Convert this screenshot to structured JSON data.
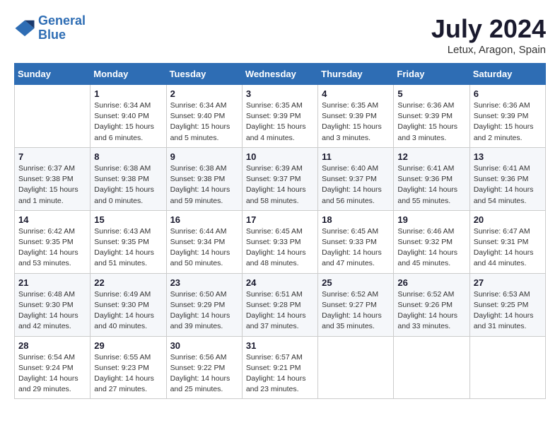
{
  "logo": {
    "line1": "General",
    "line2": "Blue"
  },
  "title": "July 2024",
  "location": "Letux, Aragon, Spain",
  "days_header": [
    "Sunday",
    "Monday",
    "Tuesday",
    "Wednesday",
    "Thursday",
    "Friday",
    "Saturday"
  ],
  "weeks": [
    [
      {
        "day": "",
        "sunrise": "",
        "sunset": "",
        "daylight": ""
      },
      {
        "day": "1",
        "sunrise": "Sunrise: 6:34 AM",
        "sunset": "Sunset: 9:40 PM",
        "daylight": "Daylight: 15 hours and 6 minutes."
      },
      {
        "day": "2",
        "sunrise": "Sunrise: 6:34 AM",
        "sunset": "Sunset: 9:40 PM",
        "daylight": "Daylight: 15 hours and 5 minutes."
      },
      {
        "day": "3",
        "sunrise": "Sunrise: 6:35 AM",
        "sunset": "Sunset: 9:39 PM",
        "daylight": "Daylight: 15 hours and 4 minutes."
      },
      {
        "day": "4",
        "sunrise": "Sunrise: 6:35 AM",
        "sunset": "Sunset: 9:39 PM",
        "daylight": "Daylight: 15 hours and 3 minutes."
      },
      {
        "day": "5",
        "sunrise": "Sunrise: 6:36 AM",
        "sunset": "Sunset: 9:39 PM",
        "daylight": "Daylight: 15 hours and 3 minutes."
      },
      {
        "day": "6",
        "sunrise": "Sunrise: 6:36 AM",
        "sunset": "Sunset: 9:39 PM",
        "daylight": "Daylight: 15 hours and 2 minutes."
      }
    ],
    [
      {
        "day": "7",
        "sunrise": "Sunrise: 6:37 AM",
        "sunset": "Sunset: 9:38 PM",
        "daylight": "Daylight: 15 hours and 1 minute."
      },
      {
        "day": "8",
        "sunrise": "Sunrise: 6:38 AM",
        "sunset": "Sunset: 9:38 PM",
        "daylight": "Daylight: 15 hours and 0 minutes."
      },
      {
        "day": "9",
        "sunrise": "Sunrise: 6:38 AM",
        "sunset": "Sunset: 9:38 PM",
        "daylight": "Daylight: 14 hours and 59 minutes."
      },
      {
        "day": "10",
        "sunrise": "Sunrise: 6:39 AM",
        "sunset": "Sunset: 9:37 PM",
        "daylight": "Daylight: 14 hours and 58 minutes."
      },
      {
        "day": "11",
        "sunrise": "Sunrise: 6:40 AM",
        "sunset": "Sunset: 9:37 PM",
        "daylight": "Daylight: 14 hours and 56 minutes."
      },
      {
        "day": "12",
        "sunrise": "Sunrise: 6:41 AM",
        "sunset": "Sunset: 9:36 PM",
        "daylight": "Daylight: 14 hours and 55 minutes."
      },
      {
        "day": "13",
        "sunrise": "Sunrise: 6:41 AM",
        "sunset": "Sunset: 9:36 PM",
        "daylight": "Daylight: 14 hours and 54 minutes."
      }
    ],
    [
      {
        "day": "14",
        "sunrise": "Sunrise: 6:42 AM",
        "sunset": "Sunset: 9:35 PM",
        "daylight": "Daylight: 14 hours and 53 minutes."
      },
      {
        "day": "15",
        "sunrise": "Sunrise: 6:43 AM",
        "sunset": "Sunset: 9:35 PM",
        "daylight": "Daylight: 14 hours and 51 minutes."
      },
      {
        "day": "16",
        "sunrise": "Sunrise: 6:44 AM",
        "sunset": "Sunset: 9:34 PM",
        "daylight": "Daylight: 14 hours and 50 minutes."
      },
      {
        "day": "17",
        "sunrise": "Sunrise: 6:45 AM",
        "sunset": "Sunset: 9:33 PM",
        "daylight": "Daylight: 14 hours and 48 minutes."
      },
      {
        "day": "18",
        "sunrise": "Sunrise: 6:45 AM",
        "sunset": "Sunset: 9:33 PM",
        "daylight": "Daylight: 14 hours and 47 minutes."
      },
      {
        "day": "19",
        "sunrise": "Sunrise: 6:46 AM",
        "sunset": "Sunset: 9:32 PM",
        "daylight": "Daylight: 14 hours and 45 minutes."
      },
      {
        "day": "20",
        "sunrise": "Sunrise: 6:47 AM",
        "sunset": "Sunset: 9:31 PM",
        "daylight": "Daylight: 14 hours and 44 minutes."
      }
    ],
    [
      {
        "day": "21",
        "sunrise": "Sunrise: 6:48 AM",
        "sunset": "Sunset: 9:30 PM",
        "daylight": "Daylight: 14 hours and 42 minutes."
      },
      {
        "day": "22",
        "sunrise": "Sunrise: 6:49 AM",
        "sunset": "Sunset: 9:30 PM",
        "daylight": "Daylight: 14 hours and 40 minutes."
      },
      {
        "day": "23",
        "sunrise": "Sunrise: 6:50 AM",
        "sunset": "Sunset: 9:29 PM",
        "daylight": "Daylight: 14 hours and 39 minutes."
      },
      {
        "day": "24",
        "sunrise": "Sunrise: 6:51 AM",
        "sunset": "Sunset: 9:28 PM",
        "daylight": "Daylight: 14 hours and 37 minutes."
      },
      {
        "day": "25",
        "sunrise": "Sunrise: 6:52 AM",
        "sunset": "Sunset: 9:27 PM",
        "daylight": "Daylight: 14 hours and 35 minutes."
      },
      {
        "day": "26",
        "sunrise": "Sunrise: 6:52 AM",
        "sunset": "Sunset: 9:26 PM",
        "daylight": "Daylight: 14 hours and 33 minutes."
      },
      {
        "day": "27",
        "sunrise": "Sunrise: 6:53 AM",
        "sunset": "Sunset: 9:25 PM",
        "daylight": "Daylight: 14 hours and 31 minutes."
      }
    ],
    [
      {
        "day": "28",
        "sunrise": "Sunrise: 6:54 AM",
        "sunset": "Sunset: 9:24 PM",
        "daylight": "Daylight: 14 hours and 29 minutes."
      },
      {
        "day": "29",
        "sunrise": "Sunrise: 6:55 AM",
        "sunset": "Sunset: 9:23 PM",
        "daylight": "Daylight: 14 hours and 27 minutes."
      },
      {
        "day": "30",
        "sunrise": "Sunrise: 6:56 AM",
        "sunset": "Sunset: 9:22 PM",
        "daylight": "Daylight: 14 hours and 25 minutes."
      },
      {
        "day": "31",
        "sunrise": "Sunrise: 6:57 AM",
        "sunset": "Sunset: 9:21 PM",
        "daylight": "Daylight: 14 hours and 23 minutes."
      },
      {
        "day": "",
        "sunrise": "",
        "sunset": "",
        "daylight": ""
      },
      {
        "day": "",
        "sunrise": "",
        "sunset": "",
        "daylight": ""
      },
      {
        "day": "",
        "sunrise": "",
        "sunset": "",
        "daylight": ""
      }
    ]
  ]
}
